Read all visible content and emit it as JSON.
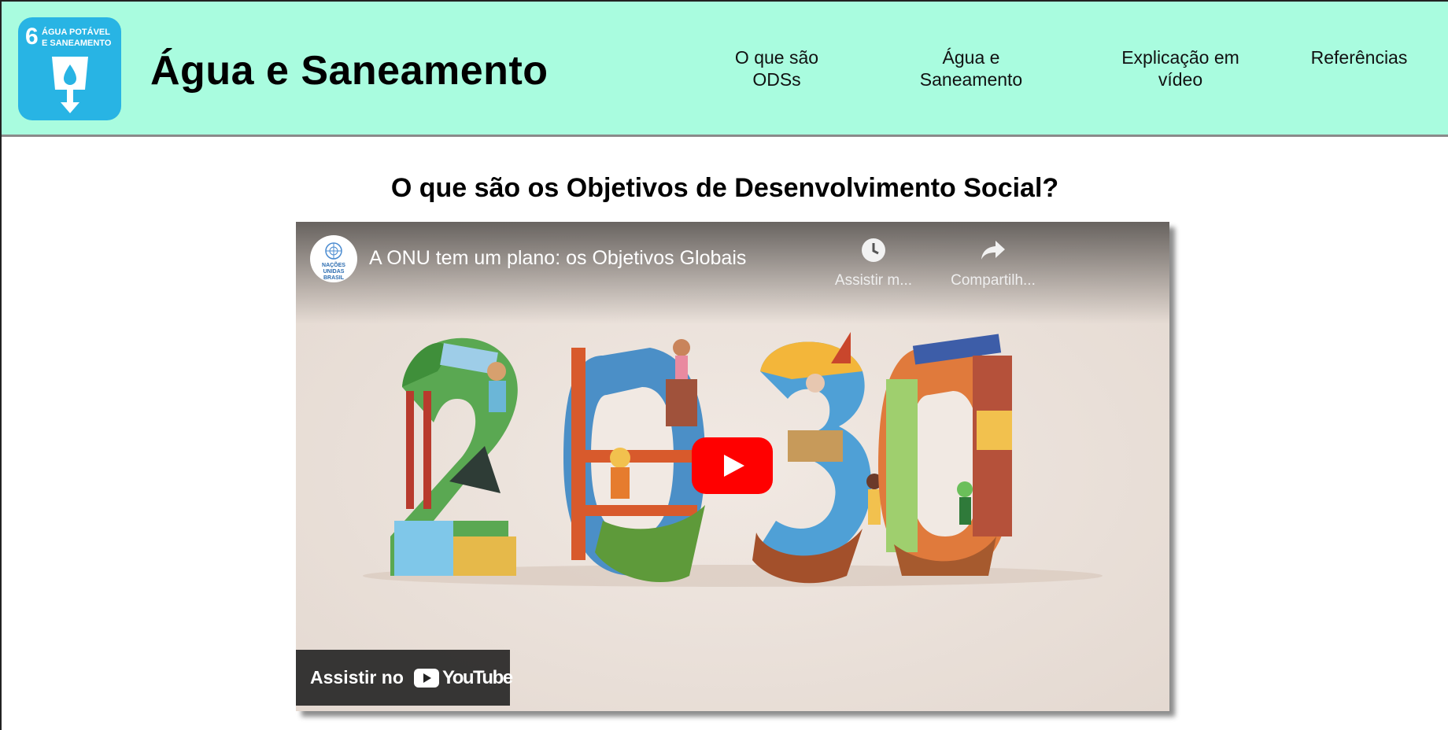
{
  "header": {
    "logo": {
      "number": "6",
      "line1": "ÁGUA POTÁVEL",
      "line2": "E SANEAMENTO",
      "icon": "water-glass-icon"
    },
    "title": "Água e Saneamento",
    "nav": [
      {
        "line1": "O que são",
        "line2": "ODSs"
      },
      {
        "line1": "Água e",
        "line2": "Saneamento"
      },
      {
        "line1": "Explicação em",
        "line2": "vídeo"
      },
      {
        "line1": "Referências",
        "line2": ""
      }
    ]
  },
  "main": {
    "heading": "O que são os Objetivos de Desenvolvimento Social?",
    "video": {
      "channel": {
        "line1": "NAÇÕES",
        "line2": "UNIDAS",
        "line3": "BRASIL"
      },
      "title": "A ONU tem um plano: os Objetivos Globais",
      "watch_later": "Assistir m...",
      "share": "Compartilh...",
      "watch_on": "Assistir no",
      "youtube": "YouTube",
      "artwork_number": "2030"
    }
  },
  "colors": {
    "header_bg": "#a9fcdf",
    "logo_bg": "#28b4e4",
    "play_red": "#ff0000"
  }
}
